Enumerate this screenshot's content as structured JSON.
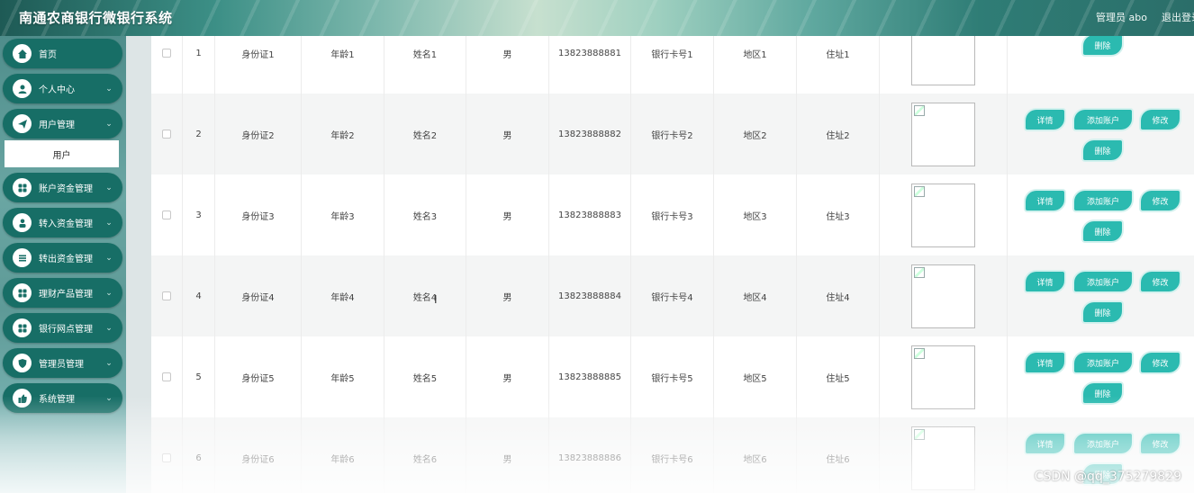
{
  "header": {
    "title": "南通农商银行微银行系统",
    "user_label": "管理员 abo",
    "logout_label": "退出登录"
  },
  "sidebar": {
    "items": [
      {
        "label": "首页",
        "icon": "home-icon"
      },
      {
        "label": "个人中心",
        "icon": "user-icon"
      },
      {
        "label": "用户管理",
        "icon": "send-icon"
      },
      {
        "label": "账户资金管理",
        "icon": "grid-icon"
      },
      {
        "label": "转入资金管理",
        "icon": "person-icon"
      },
      {
        "label": "转出资金管理",
        "icon": "list-icon"
      },
      {
        "label": "理财产品管理",
        "icon": "grid-icon"
      },
      {
        "label": "银行网点管理",
        "icon": "grid-icon"
      },
      {
        "label": "管理员管理",
        "icon": "shield-icon"
      },
      {
        "label": "系统管理",
        "icon": "thumb-icon"
      }
    ],
    "sub_item": "用户"
  },
  "table": {
    "rows": [
      {
        "index": "1",
        "id_card": "身份证1",
        "age": "年龄1",
        "name": "姓名1",
        "sex": "男",
        "phone": "13823888881",
        "card": "银行卡号1",
        "area": "地区1",
        "address": "住址1"
      },
      {
        "index": "2",
        "id_card": "身份证2",
        "age": "年龄2",
        "name": "姓名2",
        "sex": "男",
        "phone": "13823888882",
        "card": "银行卡号2",
        "area": "地区2",
        "address": "住址2"
      },
      {
        "index": "3",
        "id_card": "身份证3",
        "age": "年龄3",
        "name": "姓名3",
        "sex": "男",
        "phone": "13823888883",
        "card": "银行卡号3",
        "area": "地区3",
        "address": "住址3"
      },
      {
        "index": "4",
        "id_card": "身份证4",
        "age": "年龄4",
        "name": "姓名4",
        "sex": "男",
        "phone": "13823888884",
        "card": "银行卡号4",
        "area": "地区4",
        "address": "住址4"
      },
      {
        "index": "5",
        "id_card": "身份证5",
        "age": "年龄5",
        "name": "姓名5",
        "sex": "男",
        "phone": "13823888885",
        "card": "银行卡号5",
        "area": "地区5",
        "address": "住址5"
      },
      {
        "index": "6",
        "id_card": "身份证6",
        "age": "年龄6",
        "name": "姓名6",
        "sex": "男",
        "phone": "13823888886",
        "card": "银行卡号6",
        "area": "地区6",
        "address": "住址6"
      }
    ],
    "actions": {
      "detail": "详情",
      "add_account": "添加账户",
      "edit": "修改",
      "delete": "删除"
    }
  },
  "watermark": "CSDN @qq_375279829",
  "colors": {
    "nav_bg": "#176e66",
    "action_button": "#2bbab0"
  }
}
